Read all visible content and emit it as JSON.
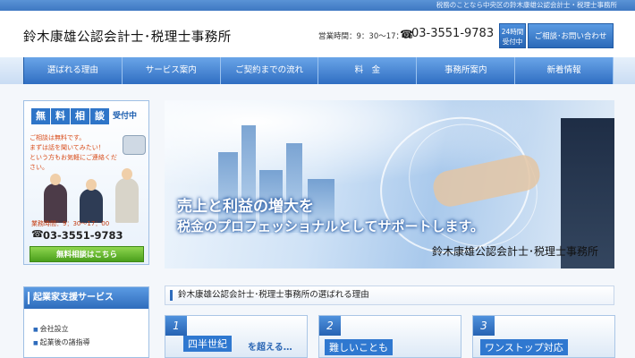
{
  "topstrip": {
    "text": "税務のことなら中央区の鈴木康雄公認会計士・税理士事務所"
  },
  "header": {
    "title": "鈴木康雄公認会計士･税理士事務所",
    "hours": "営業時間：9：30〜17：15",
    "phone": "03-3551-9783",
    "badge_24": "24時間",
    "badge_accepting": "受付中",
    "contact_button": "ご相談･お問い合わせ"
  },
  "nav": {
    "items": [
      "選ばれる理由",
      "サービス案内",
      "ご契約までの流れ",
      "料　金",
      "事務所案内",
      "新着情報"
    ]
  },
  "consult": {
    "chars": [
      "無",
      "料",
      "相",
      "談"
    ],
    "accepting": "受付中",
    "text_lines": [
      "ご相談は無料です。",
      "まずは話を聞いてみたい！",
      "という方もお気軽にご連絡ください。"
    ],
    "hours": "業務時間：9：30〜17：00",
    "phone": "03-3551-9783",
    "button": "無料相談はこちら"
  },
  "hero": {
    "line1": "売上と利益の増大を",
    "line2": "税金のプロフェッショナルとしてサポートします。",
    "sub": "鈴木康雄公認会計士･税理士事務所"
  },
  "sidebar_services": {
    "title": "起業家支援サービス",
    "items": [
      "会社設立",
      "起業後の諸指導"
    ]
  },
  "section": {
    "title": "鈴木康雄公認会計士･税理士事務所の選ばれる理由"
  },
  "reasons": [
    {
      "num": "1",
      "text": "四半世紀",
      "text_rest": "を超える…"
    },
    {
      "num": "2",
      "text": "難しいことも",
      "text_rest": ""
    },
    {
      "num": "3",
      "text": "ワンストップ対応",
      "text_rest": ""
    }
  ],
  "colors": {
    "primary_blue": "#2e6cbc",
    "accent_green": "#4a9f1c",
    "accent_orange": "#d94c1a"
  }
}
